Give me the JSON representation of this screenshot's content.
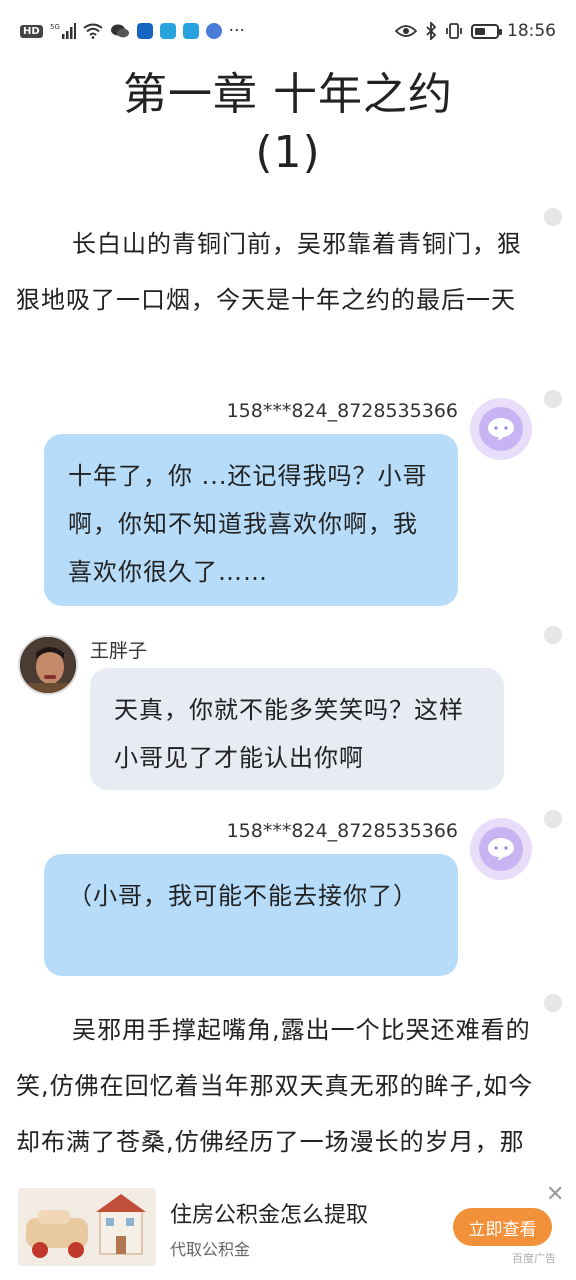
{
  "status_bar": {
    "network": "5G",
    "time": "18:56",
    "more": "···"
  },
  "chapter": {
    "title_line1": "第一章  十年之约",
    "title_line2": "(1)"
  },
  "narration": {
    "p1": "长白山的青铜门前，吴邪靠着青铜门，狠狠地吸了一口烟，今天是十年之约的最后一天",
    "p2": "吴邪用手撑起嘴角,露出一个比哭还难看的笑,仿佛在回忆着当年那双天真无邪的眸子,如今却布满了苍桑,仿佛经历了一场漫长的岁月，那单纯明亮的双眸也拿已变得"
  },
  "messages": [
    {
      "sender": "158***824_8728535366",
      "text": "十年了，你 ...还记得我吗？小哥啊，你知不知道我喜欢你啊，我喜欢你很久了……"
    },
    {
      "sender": "王胖子",
      "text": "天真，你就不能多笑笑吗？这样小哥见了才能认出你啊"
    },
    {
      "sender": "158***824_8728535366",
      "text": "（小哥，我可能不能去接你了）"
    }
  ],
  "ad": {
    "title": "住房公积金怎么提取",
    "subtitle": "代取公积金",
    "button": "立即查看",
    "close": "✕",
    "tag": "百度广告"
  },
  "colors": {
    "bubble_self": "#b7dcfa",
    "bubble_other": "#e7ebf2",
    "ad_button": "#f2913a",
    "bot_avatar": "#c9b4f3"
  },
  "icons": [
    "hd-icon",
    "signal-icon",
    "wifi-icon",
    "wechat-icon",
    "app-icon",
    "eye-icon",
    "bluetooth-icon",
    "vibrate-icon",
    "battery-icon",
    "chat-bubble-icon",
    "close-icon"
  ]
}
